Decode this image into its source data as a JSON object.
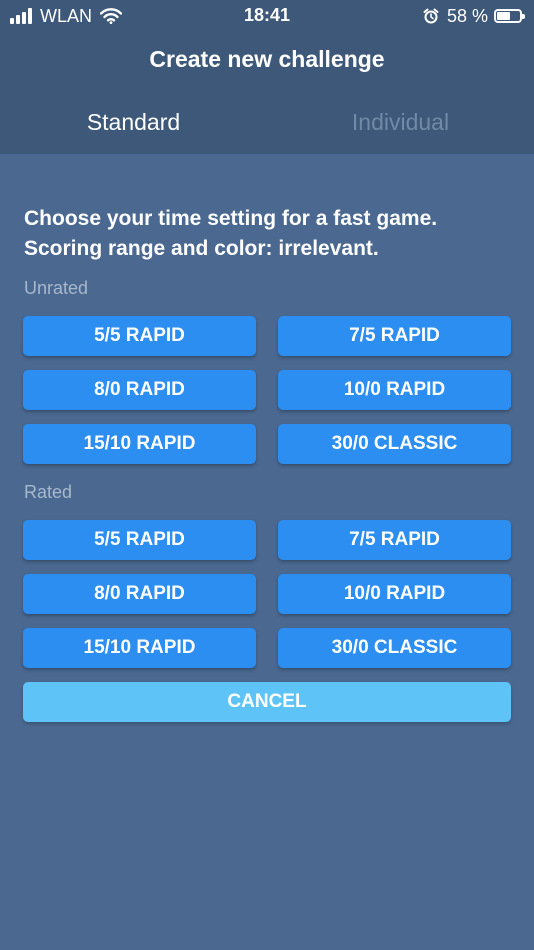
{
  "status_bar": {
    "carrier": "WLAN",
    "time": "18:41",
    "battery": "58 %",
    "battery_level": 0.58
  },
  "header": {
    "title": "Create new challenge",
    "tabs": [
      {
        "label": "Standard",
        "active": true
      },
      {
        "label": "Individual",
        "active": false
      }
    ]
  },
  "main": {
    "prompt_line1": "Choose your time setting for a fast game.",
    "prompt_line2": "Scoring range and color: irrelevant.",
    "unrated": {
      "label": "Unrated",
      "buttons": [
        "5/5 RAPID",
        "7/5 RAPID",
        "8/0 RAPID",
        "10/0 RAPID",
        "15/10 RAPID",
        "30/0 CLASSIC"
      ]
    },
    "rated": {
      "label": "Rated",
      "buttons": [
        "5/5 RAPID",
        "7/5 RAPID",
        "8/0 RAPID",
        "10/0 RAPID",
        "15/10 RAPID",
        "30/0 CLASSIC"
      ]
    },
    "cancel_label": "CANCEL"
  },
  "colors": {
    "background": "#4a6890",
    "header_background": "#3d5878",
    "button": "#2b8ef0",
    "cancel_button": "#5ec4f8",
    "inactive_tab": "#7289a8"
  },
  "icons": [
    "signal-icon",
    "wifi-icon",
    "alarm-icon",
    "battery-icon"
  ]
}
